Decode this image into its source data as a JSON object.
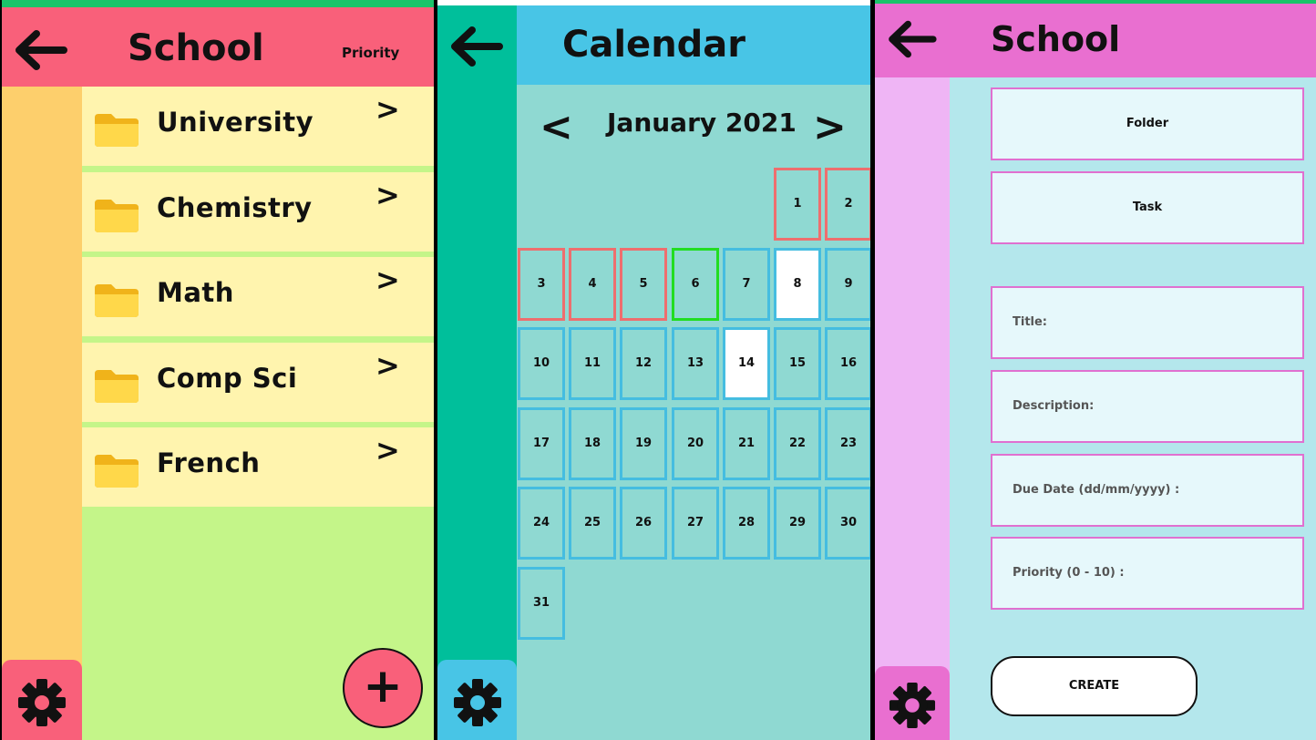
{
  "colors": {
    "school_header": "#f9607a",
    "school_sidebar": "#fdcf6c",
    "folder_row": "#fff4ae",
    "school_bg": "#c4f589",
    "calendar_header": "#48c5e6",
    "calendar_sidebar": "#00bf9b",
    "calendar_bg": "#8fd9d2",
    "form_header": "#e96fd0",
    "form_sidebar": "#efb5f5",
    "form_bg": "#b4e7ec",
    "top_accent": "#19c46a"
  },
  "folder_screen": {
    "title": "School",
    "priority_label": "Priority",
    "back_icon": "arrow-left-icon",
    "folders": [
      {
        "name": "University",
        "icon": "folder-icon",
        "chevron": ">"
      },
      {
        "name": "Chemistry",
        "icon": "folder-icon",
        "chevron": ">"
      },
      {
        "name": "Math",
        "icon": "folder-icon",
        "chevron": ">"
      },
      {
        "name": "Comp Sci",
        "icon": "folder-icon",
        "chevron": ">"
      },
      {
        "name": "French",
        "icon": "folder-icon",
        "chevron": ">"
      }
    ],
    "settings_icon": "gear-icon",
    "add_label": "+"
  },
  "calendar_screen": {
    "title": "Calendar",
    "back_icon": "arrow-left-icon",
    "prev_label": "<",
    "next_label": ">",
    "month_label": "January 2021",
    "first_weekday_index": 5,
    "days": [
      {
        "label": "1",
        "state": "past"
      },
      {
        "label": "2",
        "state": "past"
      },
      {
        "label": "3",
        "state": "past"
      },
      {
        "label": "4",
        "state": "past"
      },
      {
        "label": "5",
        "state": "past"
      },
      {
        "label": "6",
        "state": "today"
      },
      {
        "label": "7",
        "state": "normal"
      },
      {
        "label": "8",
        "state": "marked"
      },
      {
        "label": "9",
        "state": "normal"
      },
      {
        "label": "10",
        "state": "normal"
      },
      {
        "label": "11",
        "state": "normal"
      },
      {
        "label": "12",
        "state": "normal"
      },
      {
        "label": "13",
        "state": "normal"
      },
      {
        "label": "14",
        "state": "marked"
      },
      {
        "label": "15",
        "state": "normal"
      },
      {
        "label": "16",
        "state": "normal"
      },
      {
        "label": "17",
        "state": "normal"
      },
      {
        "label": "18",
        "state": "normal"
      },
      {
        "label": "19",
        "state": "normal"
      },
      {
        "label": "20",
        "state": "normal"
      },
      {
        "label": "21",
        "state": "normal"
      },
      {
        "label": "22",
        "state": "normal"
      },
      {
        "label": "23",
        "state": "normal"
      },
      {
        "label": "24",
        "state": "normal"
      },
      {
        "label": "25",
        "state": "normal"
      },
      {
        "label": "26",
        "state": "normal"
      },
      {
        "label": "27",
        "state": "normal"
      },
      {
        "label": "28",
        "state": "normal"
      },
      {
        "label": "29",
        "state": "normal"
      },
      {
        "label": "30",
        "state": "normal"
      },
      {
        "label": "31",
        "state": "normal"
      }
    ],
    "settings_icon": "gear-icon"
  },
  "create_screen": {
    "title": "School",
    "back_icon": "arrow-left-icon",
    "type_options": [
      "Folder",
      "Task"
    ],
    "fields": {
      "title": "Title:",
      "description": "Description:",
      "due_date": "Due Date (dd/mm/yyyy) :",
      "priority": "Priority (0 - 10) :"
    },
    "create_label": "CREATE",
    "settings_icon": "gear-icon"
  }
}
